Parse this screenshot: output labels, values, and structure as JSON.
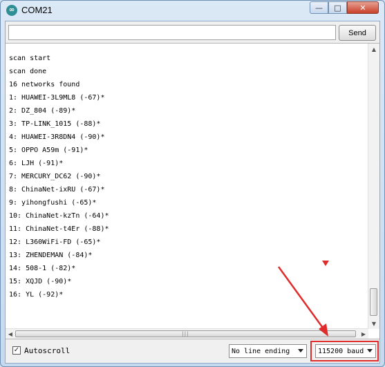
{
  "window": {
    "title": "COM21",
    "app_icon": "arduino-infinity-icon"
  },
  "titlebar_buttons": {
    "minimize": "—",
    "maximize": "□",
    "close": "✕"
  },
  "send_bar": {
    "input_value": "",
    "send_label": "Send"
  },
  "console": {
    "lines": [
      "scan start",
      "scan done",
      "16 networks found",
      "1: HUAWEI-3L9ML8 (-67)*",
      "2: DZ_804 (-89)*",
      "3: TP-LINK_1015 (-88)*",
      "4: HUAWEI-3R8DN4 (-90)*",
      "5: OPPO A59m (-91)*",
      "6: LJH (-91)*",
      "7: MERCURY_DC62 (-90)*",
      "8: ChinaNet-ixRU (-67)*",
      "9: yihongfushi (-65)*",
      "10: ChinaNet-kzTn (-64)*",
      "11: ChinaNet-t4Er (-88)*",
      "12: L360WiFi-FD (-65)*",
      "13: ZHENDEMAN (-84)*",
      "14: 508-1 (-82)*",
      "15: XQJD (-90)*",
      "16: YL (-92)*"
    ]
  },
  "footer": {
    "autoscroll_label": "Autoscroll",
    "autoscroll_checked": true,
    "line_ending": "No line ending",
    "baud": "115200 baud"
  },
  "colors": {
    "annotation": "#e02b2b",
    "window_frame": "#6f8fb3"
  }
}
